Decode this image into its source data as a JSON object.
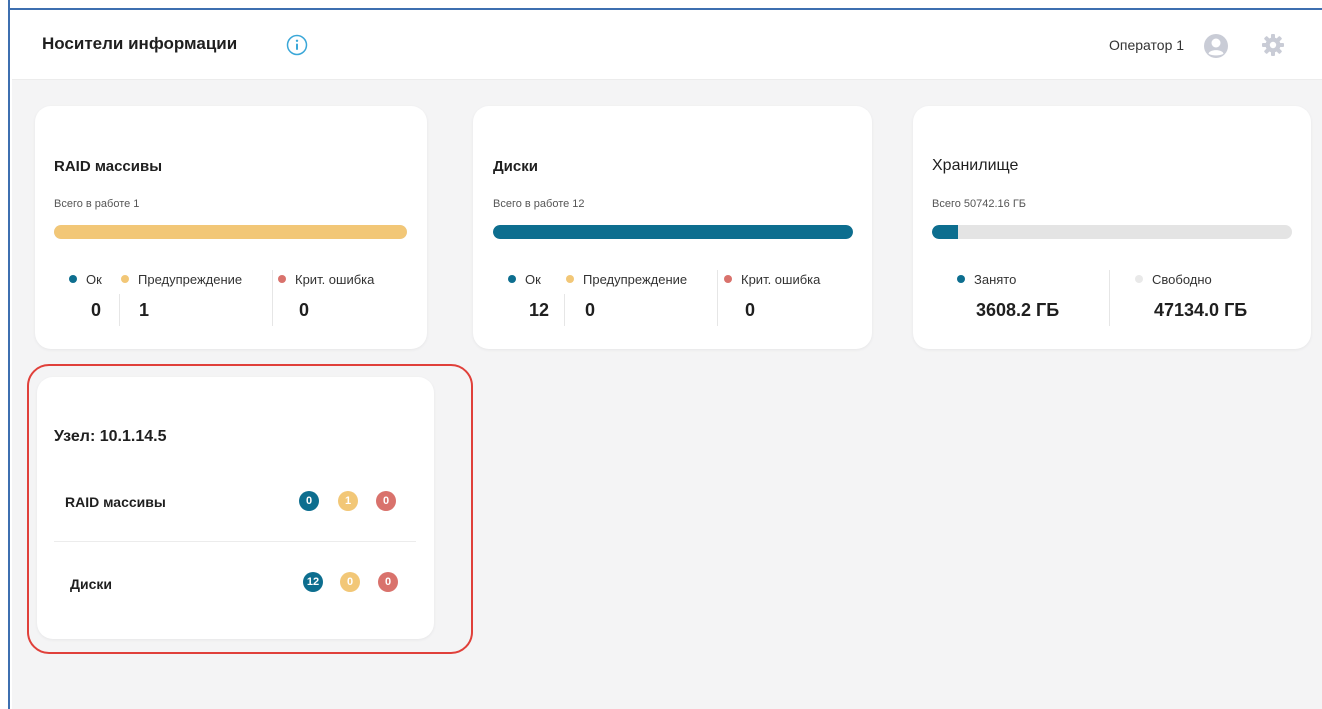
{
  "header": {
    "title": "Носители информации",
    "operator": "Оператор 1"
  },
  "colors": {
    "ok": "#0d6e8f",
    "warning": "#f2c777",
    "critical": "#d9726c",
    "used": "#0d6e8f",
    "free": "#e4e4e4"
  },
  "raid": {
    "title": "RAID массивы",
    "subtitle": "Всего в работе 1",
    "progress_warning": 1.0,
    "legend": {
      "ok": "Ок",
      "warning": "Предупреждение",
      "critical": "Крит. ошибка"
    },
    "values": {
      "ok": "0",
      "warning": "1",
      "critical": "0"
    }
  },
  "disks": {
    "title": "Диски",
    "subtitle": "Всего в работе 12",
    "progress_ok": 1.0,
    "legend": {
      "ok": "Ок",
      "warning": "Предупреждение",
      "critical": "Крит. ошибка"
    },
    "values": {
      "ok": "12",
      "warning": "0",
      "critical": "0"
    }
  },
  "storage": {
    "title": "Хранилище",
    "subtitle": "Всего 50742.16 ГБ",
    "used_fraction": 0.071,
    "used_label": "Занято",
    "free_label": "Свободно",
    "used_value": "3608.2 ГБ",
    "free_value": "47134.0 ГБ"
  },
  "node": {
    "title": "Узел: 10.1.14.5",
    "rows": [
      {
        "label": "RAID массивы",
        "ok": "0",
        "warning": "1",
        "critical": "0"
      },
      {
        "label": "Диски",
        "ok": "12",
        "warning": "0",
        "critical": "0"
      }
    ]
  }
}
